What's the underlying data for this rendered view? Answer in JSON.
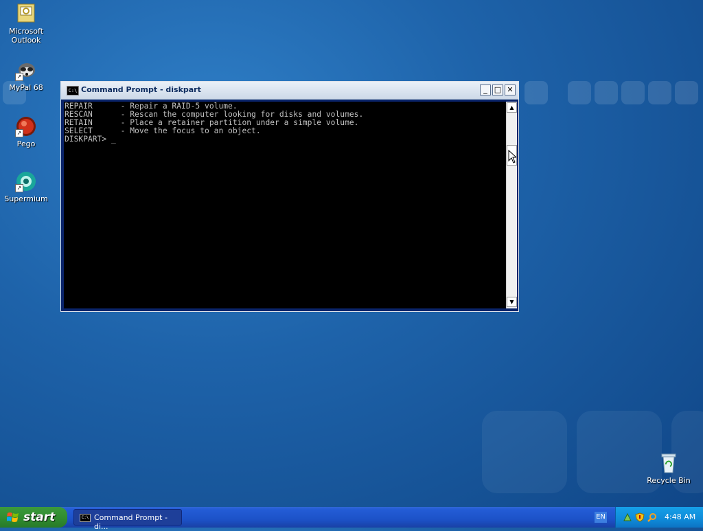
{
  "desktop": {
    "icons": [
      {
        "label_line1": "Microsoft",
        "label_line2": "Outlook",
        "icon": "outlook-icon"
      },
      {
        "label_line1": "MyPal 68",
        "label_line2": "",
        "icon": "raccoon-icon"
      },
      {
        "label_line1": "Pego",
        "label_line2": "",
        "icon": "pego-icon"
      },
      {
        "label_line1": "Supermium",
        "label_line2": "",
        "icon": "supermium-icon"
      },
      {
        "label_line1": "Recycle Bin",
        "label_line2": "",
        "icon": "recycle-bin-icon"
      }
    ]
  },
  "window": {
    "title": "Command Prompt - diskpart",
    "app_icon_text": "C:\\",
    "minimize": "_",
    "maximize": "□",
    "close": "✕",
    "console_lines": [
      "REPAIR      - Repair a RAID-5 volume.",
      "RESCAN      - Rescan the computer looking for disks and volumes.",
      "RETAIN      - Place a retainer partition under a simple volume.",
      "SELECT      - Move the focus to an object.",
      "",
      "DISKPART> _"
    ],
    "scroll_up": "▲",
    "scroll_down": "▼"
  },
  "taskbar": {
    "start_label": "start",
    "task_label": "Command Prompt - di...",
    "task_icon_text": "C:\\",
    "language": "EN",
    "clock": "4:48 AM"
  },
  "colors": {
    "desktop": "#1e63aa",
    "taskbar": "#245dd7",
    "start": "#2f8a2f",
    "tray": "#0f8ad8",
    "console_bg": "#000000",
    "console_fg": "#c0c0c0"
  }
}
